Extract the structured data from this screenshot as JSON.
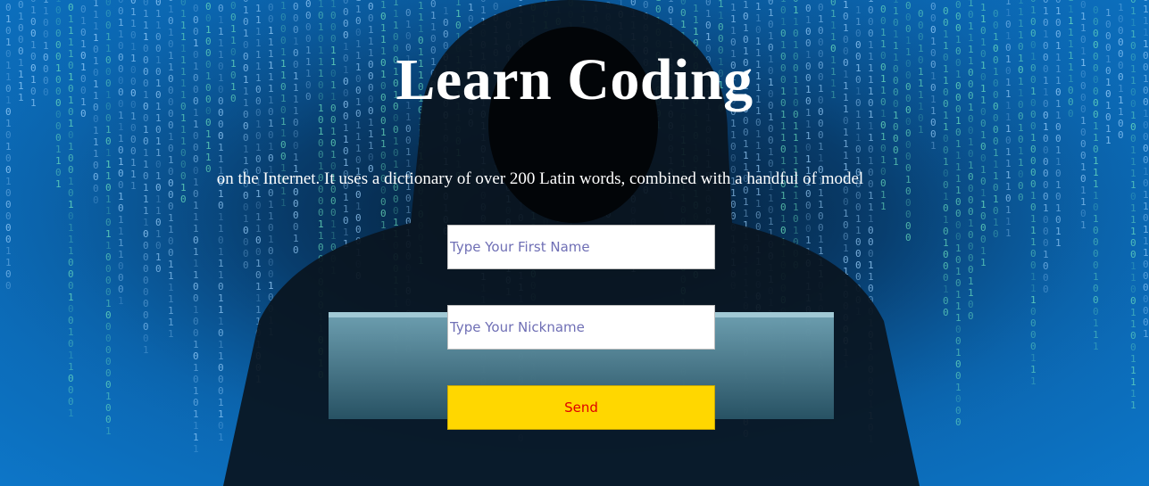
{
  "hero": {
    "title": "Learn Coding",
    "text": "on the Internet. It uses a dictionary of over 200 Latin words, combined with a handful of model"
  },
  "form": {
    "first_name": {
      "placeholder": "Type Your First Name",
      "value": ""
    },
    "nickname": {
      "placeholder": "Type Your Nickname",
      "value": ""
    },
    "send_label": "Send"
  },
  "colors": {
    "background_blue": "#0b66b0",
    "button_background": "#ffd700",
    "button_text": "#e00000",
    "placeholder_text": "#6f6fb5",
    "heading_text": "#ffffff"
  },
  "background_image": {
    "icon": "hooded-hacker-binary-rain"
  }
}
